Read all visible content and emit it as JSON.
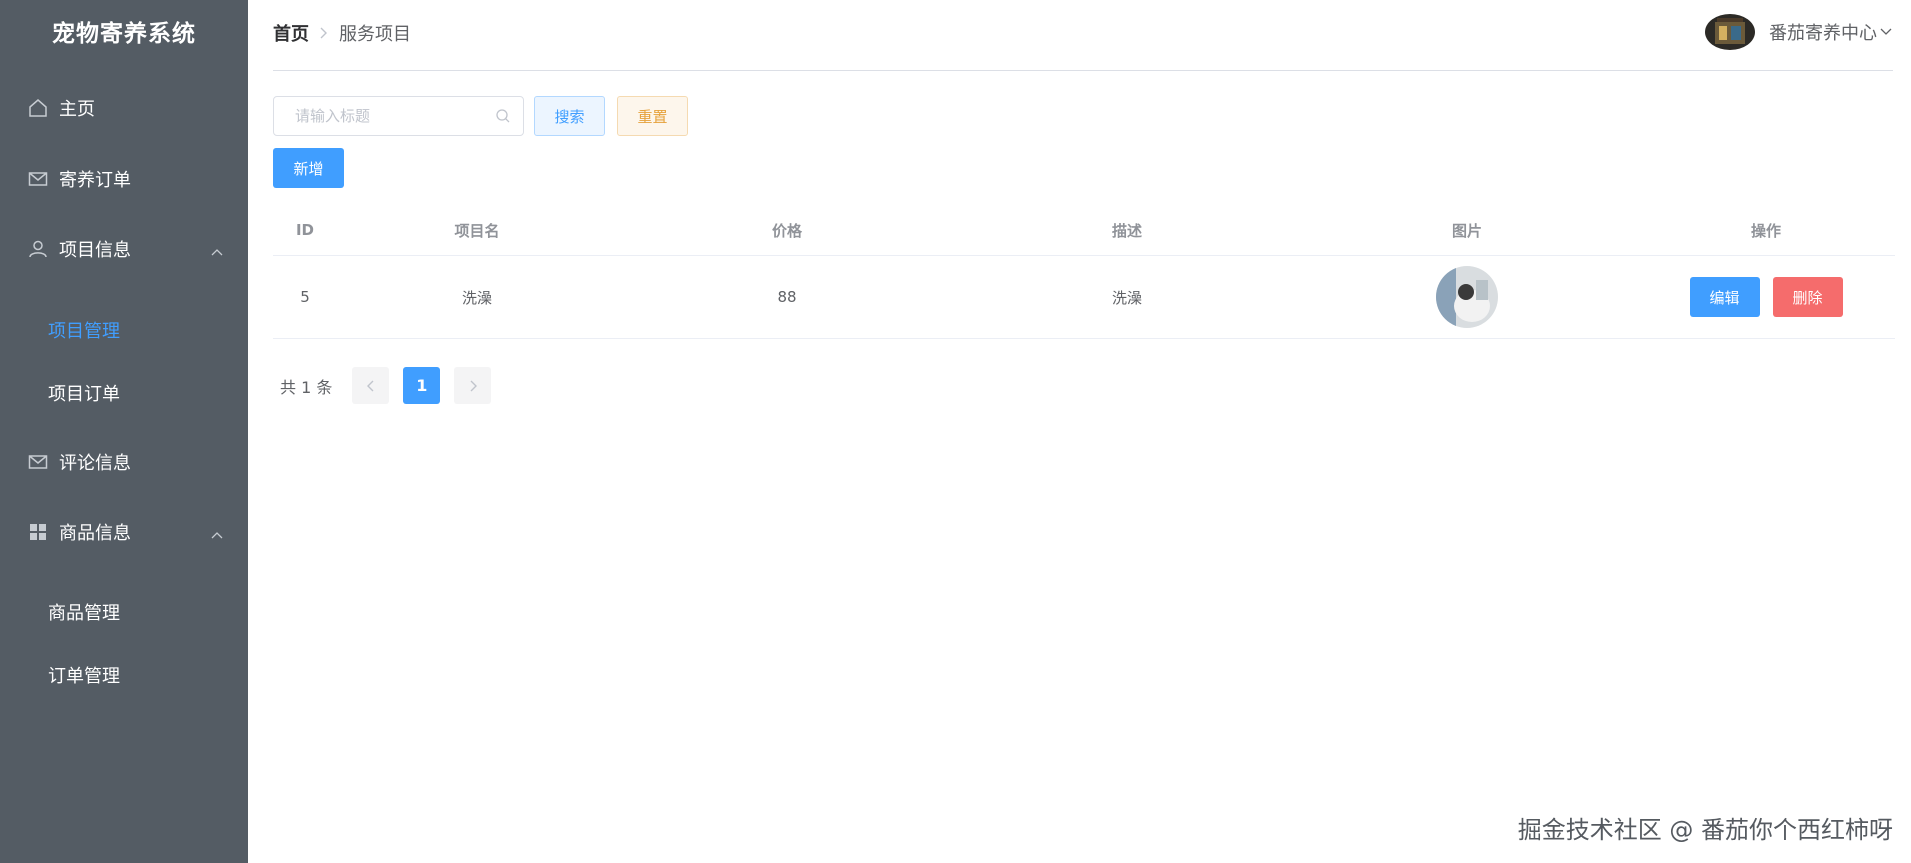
{
  "sidebar": {
    "title": "宠物寄养系统",
    "items": [
      {
        "label": "主页",
        "icon": "home-icon"
      },
      {
        "label": "寄养订单",
        "icon": "mail-icon"
      },
      {
        "label": "项目信息",
        "icon": "user-icon",
        "expanded": true,
        "children": [
          {
            "label": "项目管理",
            "active": true
          },
          {
            "label": "项目订单"
          }
        ]
      },
      {
        "label": "评论信息",
        "icon": "mail-icon"
      },
      {
        "label": "商品信息",
        "icon": "grid-icon",
        "expanded": true,
        "children": [
          {
            "label": "商品管理"
          },
          {
            "label": "订单管理"
          }
        ]
      }
    ]
  },
  "header": {
    "breadcrumb": {
      "home": "首页",
      "current": "服务项目"
    },
    "user_name": "番茄寄养中心"
  },
  "toolbar": {
    "search_placeholder": "请输入标题",
    "search_label": "搜索",
    "reset_label": "重置",
    "add_label": "新增"
  },
  "table": {
    "columns": [
      "ID",
      "项目名",
      "价格",
      "描述",
      "图片",
      "操作"
    ],
    "rows": [
      {
        "id": "5",
        "name": "洗澡",
        "price": "88",
        "desc": "洗澡",
        "image": "pet-photo"
      }
    ],
    "edit_label": "编辑",
    "delete_label": "删除"
  },
  "pagination": {
    "total_text": "共 1 条",
    "current_page": "1"
  },
  "watermark": "掘金技术社区 @ 番茄你个西红柿呀",
  "colors": {
    "sidebar_bg": "#545c64",
    "primary": "#409eff",
    "danger": "#f56c6c",
    "warning": "#e6a23c"
  }
}
